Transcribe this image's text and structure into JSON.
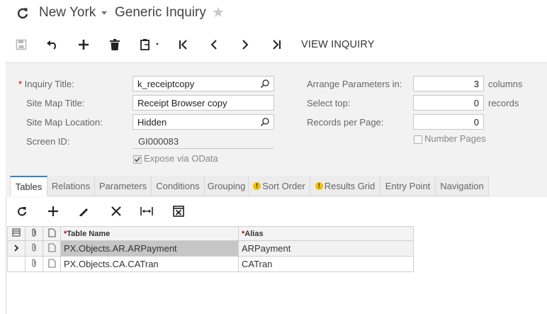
{
  "header": {
    "company": "New York",
    "screen_title": "Generic Inquiry"
  },
  "toolbar": {
    "view_inquiry_label": "VIEW INQUIRY"
  },
  "form": {
    "inquiry_title_label": "Inquiry Title:",
    "inquiry_title_value": "k_receiptcopy",
    "site_map_title_label": "Site Map Title:",
    "site_map_title_value": "Receipt Browser copy",
    "site_map_location_label": "Site Map Location:",
    "site_map_location_value": "Hidden",
    "screen_id_label": "Screen ID:",
    "screen_id_value": "GI000083",
    "expose_odata_label": "Expose via OData",
    "expose_odata_checked": true,
    "arrange_params_label": "Arrange Parameters in:",
    "arrange_params_value": "3",
    "arrange_params_unit": "columns",
    "select_top_label": "Select top:",
    "select_top_value": "0",
    "select_top_unit": "records",
    "records_per_page_label": "Records per Page:",
    "records_per_page_value": "0",
    "number_pages_label": "Number Pages",
    "number_pages_checked": false
  },
  "tabs": [
    {
      "label": "Tables",
      "active": true
    },
    {
      "label": "Relations"
    },
    {
      "label": "Parameters"
    },
    {
      "label": "Conditions"
    },
    {
      "label": "Grouping"
    },
    {
      "label": "Sort Order",
      "warning": true
    },
    {
      "label": "Results Grid",
      "warning": true
    },
    {
      "label": "Entry Point"
    },
    {
      "label": "Navigation"
    }
  ],
  "grid": {
    "columns": [
      "Table Name",
      "Alias"
    ],
    "rows": [
      {
        "table_name": "PX.Objects.AR.ARPayment",
        "alias": "ARPayment",
        "selected": true
      },
      {
        "table_name": "PX.Objects.CA.CATran",
        "alias": "CATran"
      }
    ]
  },
  "colors": {
    "accent": "#2f86c7",
    "required": "#cc0000",
    "warning": "#f0c000"
  }
}
